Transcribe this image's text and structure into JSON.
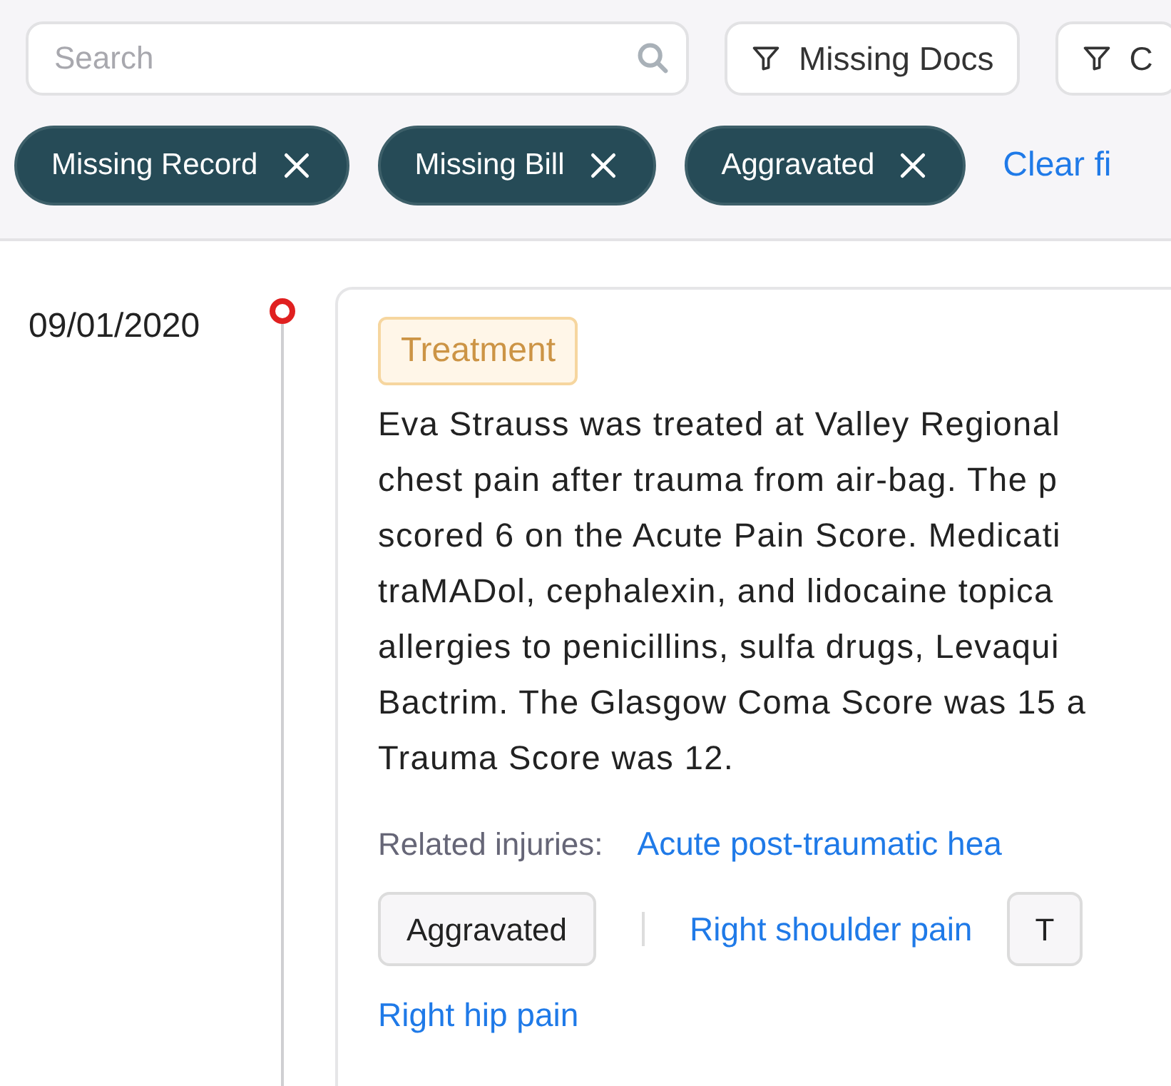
{
  "search": {
    "placeholder": "Search"
  },
  "filter_buttons": [
    {
      "label": "Missing Docs"
    },
    {
      "label": "C"
    }
  ],
  "active_filters": [
    {
      "label": "Missing Record"
    },
    {
      "label": "Missing Bill"
    },
    {
      "label": "Aggravated"
    }
  ],
  "clear_filters": "Clear fi",
  "timeline": [
    {
      "date": "09/01/2020",
      "tag": "Treatment",
      "summary_lines": [
        "Eva Strauss was treated at Valley Regional",
        "chest pain after trauma from air-bag. The p",
        "scored 6 on the Acute Pain Score. Medicati",
        "traMADol, cephalexin, and lidocaine topica",
        "allergies to penicillins, sulfa drugs, Levaqui",
        "Bactrim. The Glasgow Coma Score was 15 a",
        "Trauma Score was 12."
      ],
      "related_label": "Related injuries:",
      "injuries": [
        {
          "kind": "link",
          "text": "Acute post-traumatic hea"
        },
        {
          "kind": "chip",
          "text": "Aggravated"
        },
        {
          "kind": "divider"
        },
        {
          "kind": "link",
          "text": "Right shoulder pain"
        },
        {
          "kind": "chip",
          "text": "T"
        },
        {
          "kind": "link",
          "text": "Right hip pain"
        }
      ]
    }
  ]
}
